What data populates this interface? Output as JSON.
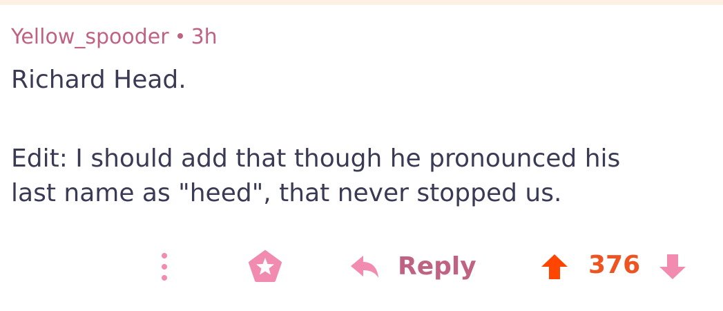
{
  "comment": {
    "author": "Yellow_spooder",
    "age": "3h",
    "body_line1": "Richard Head.",
    "body_line2": "Edit: I should add that though he pronounced his",
    "body_line3": "last name as \"heed\", that never stopped us."
  },
  "actions": {
    "more_icon": "vertical-ellipsis",
    "award_icon": "star-badge",
    "reply_icon": "reply-arrow",
    "reply_label": "Reply",
    "upvote_icon": "arrow-up",
    "score": "376",
    "downvote_icon": "arrow-down"
  },
  "colors": {
    "meta": "#c06282",
    "body_text": "#3a3a55",
    "accent_pink": "#f28bb0",
    "upvote": "#ff4500",
    "score": "#ed5422",
    "top_strip": "#fdf1e4"
  }
}
